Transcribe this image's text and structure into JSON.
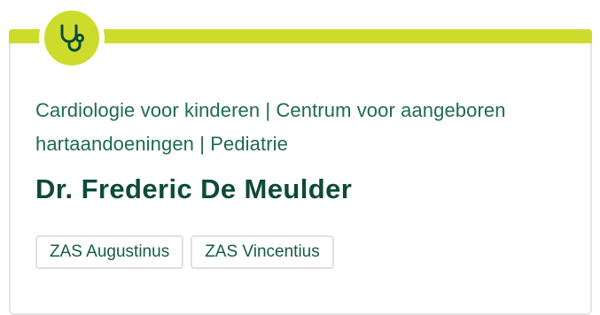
{
  "card": {
    "icon": "stethoscope-icon",
    "accent_color": "#cddc2c",
    "specialties": "Cardiologie voor kinderen | Centrum voor aangeboren hartaandoeningen | Pediatrie",
    "doctor_name": "Dr. Frederic De Meulder",
    "locations": [
      {
        "label": "ZAS Augustinus"
      },
      {
        "label": "ZAS Vincentius"
      }
    ]
  }
}
